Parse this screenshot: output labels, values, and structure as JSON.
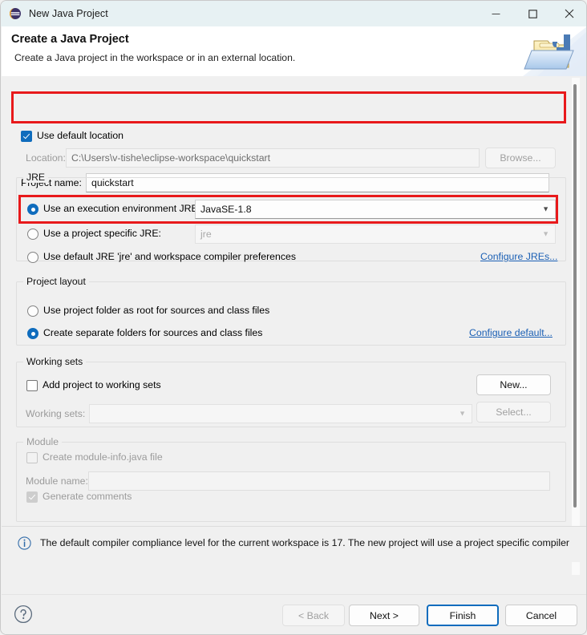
{
  "window": {
    "title": "New Java Project",
    "app_icon": "eclipse-icon",
    "controls": {
      "minimize": "minimize-icon",
      "maximize": "maximize-icon",
      "close": "close-icon"
    }
  },
  "header": {
    "title": "Create a Java Project",
    "subtitle": "Create a Java project in the workspace or in an external location.",
    "art_icon": "java-project-folder-icon"
  },
  "project": {
    "name_label": "Project name:",
    "name_value": "quickstart",
    "use_default_location_label": "Use default location",
    "use_default_location_checked": true,
    "location_label": "Location:",
    "location_value": "C:\\Users\\v-tishe\\eclipse-workspace\\quickstart",
    "browse_label": "Browse..."
  },
  "jre": {
    "group_title": "JRE",
    "option_execution_env": "Use an execution environment JRE:",
    "execution_env_value": "JavaSE-1.8",
    "option_project_specific": "Use a project specific JRE:",
    "project_specific_value": "jre",
    "option_default_jre": "Use default JRE 'jre' and workspace compiler preferences",
    "configure_link": "Configure JREs...",
    "selected": "execution_env"
  },
  "layout": {
    "group_title": "Project layout",
    "option_root": "Use project folder as root for sources and class files",
    "option_separate": "Create separate folders for sources and class files",
    "configure_link": "Configure default...",
    "selected": "separate"
  },
  "working_sets": {
    "group_title": "Working sets",
    "add_label": "Add project to working sets",
    "add_checked": false,
    "sets_label": "Working sets:",
    "sets_value": "",
    "new_label": "New...",
    "select_label": "Select..."
  },
  "module": {
    "group_title": "Module",
    "create_label": "Create module-info.java file",
    "create_checked": false,
    "name_label": "Module name:",
    "name_value": "",
    "generate_comments_label": "Generate comments",
    "generate_comments_checked": true
  },
  "info": {
    "icon": "info-icon",
    "message": "The default compiler compliance level for the current workspace is 17. The new project will use a project specific compiler"
  },
  "footer": {
    "help_icon": "help-icon",
    "back_label": "< Back",
    "next_label": "Next >",
    "finish_label": "Finish",
    "cancel_label": "Cancel"
  },
  "colors": {
    "accent": "#0f6cbd",
    "annotation": "#e8191b",
    "link": "#1a5fb4",
    "titlebar": "#e7f1f3"
  }
}
